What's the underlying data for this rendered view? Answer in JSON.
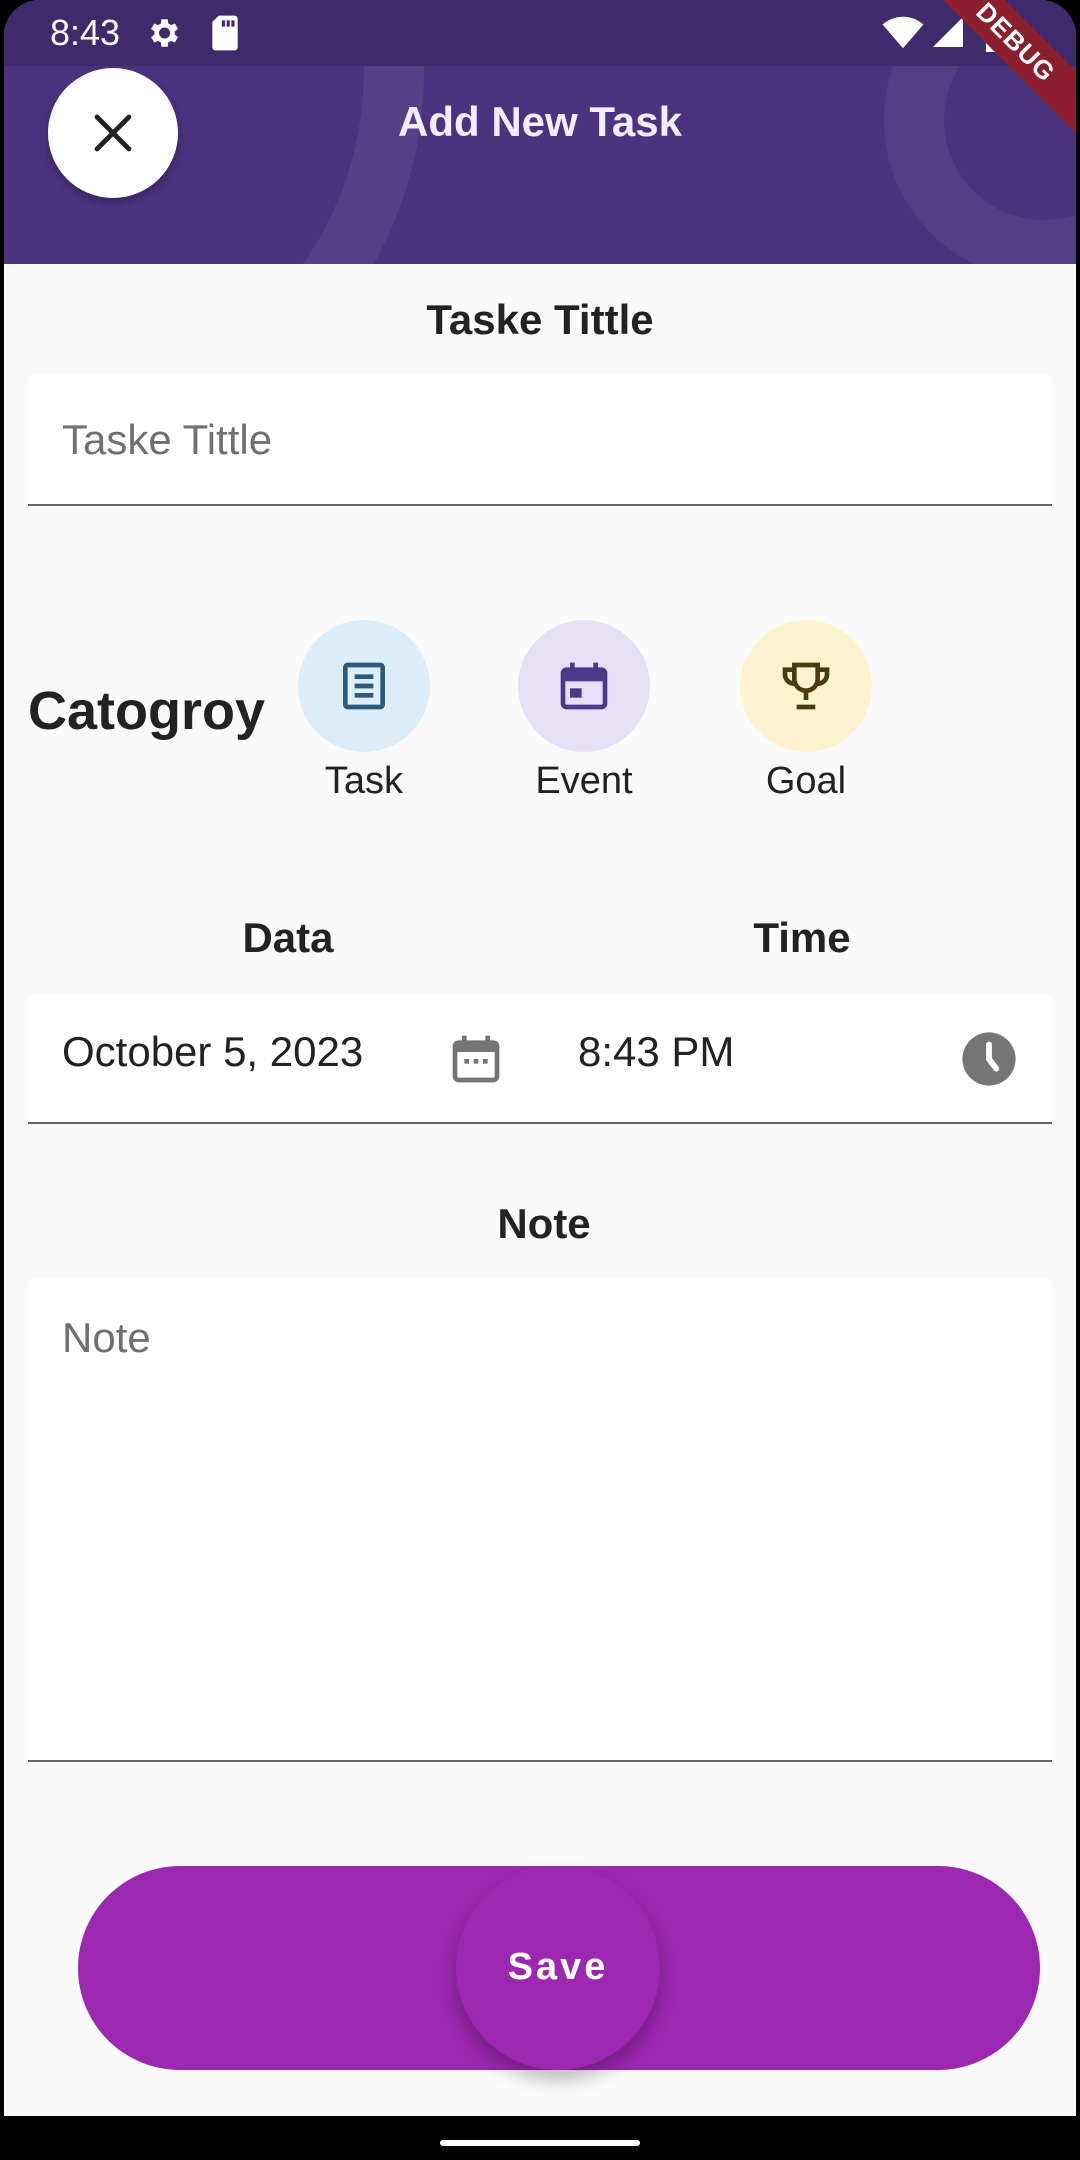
{
  "status_bar": {
    "time": "8:43"
  },
  "debug_banner": "DEBUG",
  "header": {
    "title": "Add New Task"
  },
  "form": {
    "title_label": "Taske Tittle",
    "title_placeholder": "Taske Tittle",
    "category_label": "Catogroy",
    "categories": [
      {
        "label": "Task",
        "icon": "document-icon",
        "color": "#dbeefa",
        "icon_color": "#2d5a7a"
      },
      {
        "label": "Event",
        "icon": "calendar-icon",
        "color": "#e6e0f5",
        "icon_color": "#4a3a8a"
      },
      {
        "label": "Goal",
        "icon": "trophy-icon",
        "color": "#fdf4cf",
        "icon_color": "#4a3a10"
      }
    ],
    "date_label": "Data",
    "date_value": "October 5, 2023",
    "time_label": "Time",
    "time_value": "8:43 PM",
    "note_label": "Note",
    "note_placeholder": "Note"
  },
  "actions": {
    "save_label": "Save"
  },
  "colors": {
    "header": "#4c3380",
    "save": "#9c27b0"
  }
}
